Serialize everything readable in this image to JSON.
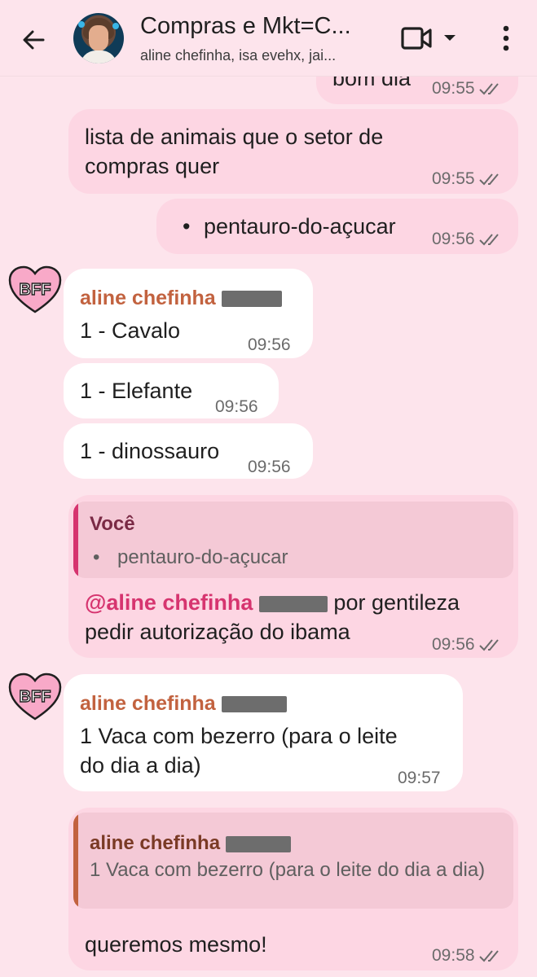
{
  "header": {
    "title": "Compras e Mkt=C...",
    "subtitle": "aline chefinha, isa evehx, jai...",
    "back_icon": "arrow-left-icon",
    "video_icon": "video-camera-icon",
    "menu_icon": "more-vertical-icon"
  },
  "messages": [
    {
      "text": "bom dia",
      "time": "09:55"
    },
    {
      "text": "lista de animais que o setor de compras quer",
      "time": "09:55"
    },
    {
      "bullet": "•",
      "text": "pentauro-do-açucar",
      "time": "09:56"
    },
    {
      "sender": "aline chefinha",
      "text": "1 - Cavalo",
      "time": "09:56"
    },
    {
      "text": "1 - Elefante",
      "time": "09:56"
    },
    {
      "text": "1 - dinossauro",
      "time": "09:56"
    },
    {
      "quote_author": "Você",
      "quote_bullet": "•",
      "quote_text": "pentauro-do-açucar",
      "mention": "@aline chefinha",
      "text_line1": "por gentileza",
      "text_line2": "pedir autorização do ibama",
      "time": "09:56"
    },
    {
      "sender": "aline chefinha",
      "text": "1 Vaca com bezerro (para o leite do dia a dia)",
      "time": "09:57"
    },
    {
      "quote_author": "aline chefinha",
      "quote_text": "1 Vaca com bezerro (para o leite do dia a dia)",
      "text": "queremos mesmo!",
      "time": "09:58"
    }
  ],
  "sticker": {
    "label": "BFF",
    "icon": "bff-heart-icon"
  },
  "colors": {
    "background": "#fde4ec",
    "outgoing_bubble": "#fdd6e3",
    "incoming_bubble": "#ffffff",
    "sender_name": "#c2623f",
    "mention": "#d6346f",
    "quote_bar_you": "#d6346f",
    "quote_bar_other": "#c2623f"
  }
}
